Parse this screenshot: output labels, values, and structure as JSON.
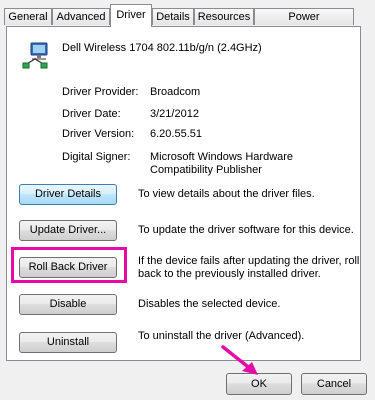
{
  "tabs": [
    {
      "label": "General"
    },
    {
      "label": "Advanced"
    },
    {
      "label": "Driver",
      "active": true
    },
    {
      "label": "Details"
    },
    {
      "label": "Resources"
    },
    {
      "label": "Power Management"
    }
  ],
  "device": {
    "name": "Dell Wireless 1704 802.11b/g/n (2.4GHz)",
    "icon": "network-adapter-icon"
  },
  "info": {
    "provider_label": "Driver Provider:",
    "provider_value": "Broadcom",
    "date_label": "Driver Date:",
    "date_value": "3/21/2012",
    "version_label": "Driver Version:",
    "version_value": "6.20.55.51",
    "signer_label": "Digital Signer:",
    "signer_value": "Microsoft Windows Hardware Compatibility Publisher"
  },
  "actions": {
    "details_label": "Driver Details",
    "details_desc": "To view details about the driver files.",
    "update_label": "Update Driver...",
    "update_desc": "To update the driver software for this device.",
    "rollback_label": "Roll Back Driver",
    "rollback_desc": "If the device fails after updating the driver, roll back to the previously installed driver.",
    "disable_label": "Disable",
    "disable_desc": "Disables the selected device.",
    "uninstall_label": "Uninstall",
    "uninstall_desc": "To uninstall the driver (Advanced)."
  },
  "footer": {
    "ok_label": "OK",
    "cancel_label": "Cancel"
  },
  "colors": {
    "highlight": "#e60aa8"
  }
}
